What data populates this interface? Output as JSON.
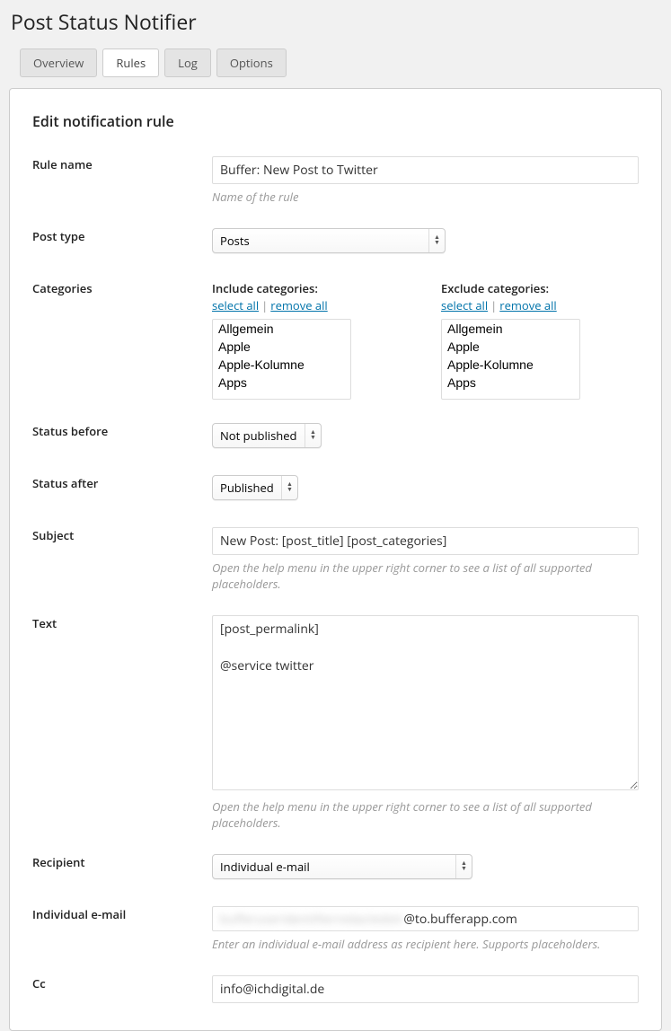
{
  "page_title": "Post Status Notifier",
  "tabs": {
    "overview": "Overview",
    "rules": "Rules",
    "log": "Log",
    "options": "Options"
  },
  "section_title": "Edit notification rule",
  "labels": {
    "rule_name": "Rule name",
    "post_type": "Post type",
    "categories": "Categories",
    "status_before": "Status before",
    "status_after": "Status after",
    "subject": "Subject",
    "text": "Text",
    "recipient": "Recipient",
    "individual_email": "Individual e-mail",
    "cc": "Cc"
  },
  "rule_name": {
    "value": "Buffer: New Post to Twitter",
    "help": "Name of the rule"
  },
  "post_type": {
    "selected": "Posts"
  },
  "categories": {
    "include_label": "Include categories:",
    "exclude_label": "Exclude categories:",
    "select_all": "select all",
    "remove_all": "remove all",
    "options": [
      "Allgemein",
      "Apple",
      "Apple-Kolumne",
      "Apps"
    ]
  },
  "status_before": {
    "selected": "Not published"
  },
  "status_after": {
    "selected": "Published"
  },
  "subject": {
    "value": "New Post: [post_title] [post_categories]",
    "help": "Open the help menu in the upper right corner to see a list of all supported placeholders."
  },
  "text": {
    "value": "[post_permalink]\n\n@service twitter",
    "help": "Open the help menu in the upper right corner to see a list of all supported placeholders."
  },
  "recipient": {
    "selected": "Individual e-mail"
  },
  "individual_email": {
    "hidden_prefix": "bufferuseridentifierredactedstr",
    "visible_suffix": "@to.bufferapp.com",
    "help": "Enter an individual e-mail address as recipient here. Supports placeholders."
  },
  "cc": {
    "value": "info@ichdigital.de"
  }
}
